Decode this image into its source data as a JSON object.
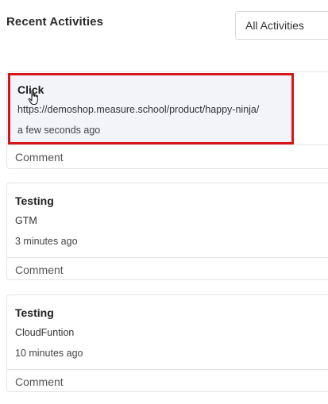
{
  "header": {
    "title": "Recent Activities",
    "filter_value": "All Activities"
  },
  "activities": [
    {
      "title": "Click",
      "description": "https://demoshop.measure.school/product/happy-ninja/",
      "time": "a few seconds ago",
      "comment_label": "Comment"
    },
    {
      "title": "Testing",
      "description": "GTM",
      "time": "3 minutes ago",
      "comment_label": "Comment"
    },
    {
      "title": "Testing",
      "description": "CloudFuntion",
      "time": "10 minutes ago",
      "comment_label": "Comment"
    }
  ],
  "colors": {
    "highlight_border": "#d8141b",
    "highlight_fill": "#f2f4fa"
  },
  "icons": {
    "cursor": "hand-pointer-icon"
  }
}
